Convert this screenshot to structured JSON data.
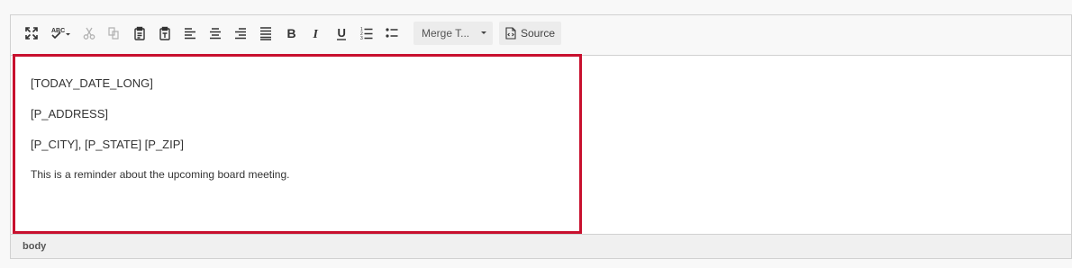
{
  "toolbar": {
    "buttons": [
      {
        "name": "maximize-icon",
        "label": "Maximize"
      },
      {
        "name": "spellcheck-icon",
        "label": "Spell Check"
      },
      {
        "name": "cut-icon",
        "label": "Cut"
      },
      {
        "name": "copy-icon",
        "label": "Copy"
      },
      {
        "name": "paste-icon",
        "label": "Paste"
      },
      {
        "name": "paste-text-icon",
        "label": "Paste as plain text"
      },
      {
        "name": "align-left-icon",
        "label": "Align Left"
      },
      {
        "name": "align-center-icon",
        "label": "Center"
      },
      {
        "name": "align-right-icon",
        "label": "Align Right"
      },
      {
        "name": "justify-icon",
        "label": "Justify"
      },
      {
        "name": "bold-icon",
        "label": "Bold"
      },
      {
        "name": "italic-icon",
        "label": "Italic"
      },
      {
        "name": "underline-icon",
        "label": "Underline"
      },
      {
        "name": "numbered-list-icon",
        "label": "Numbered List"
      },
      {
        "name": "bulleted-list-icon",
        "label": "Bulleted List"
      }
    ],
    "merge_tags_label": "Merge T...",
    "source_label": "Source"
  },
  "content": {
    "lines": [
      "[TODAY_DATE_LONG]",
      "[P_ADDRESS]",
      "[P_CITY], [P_STATE] [P_ZIP]",
      "This is a reminder about the upcoming board meeting."
    ]
  },
  "statusbar": {
    "path": "body"
  },
  "colors": {
    "focus_border": "#c8102e",
    "toolbar_bg": "#f8f8f8",
    "button_bg": "#ececec"
  }
}
